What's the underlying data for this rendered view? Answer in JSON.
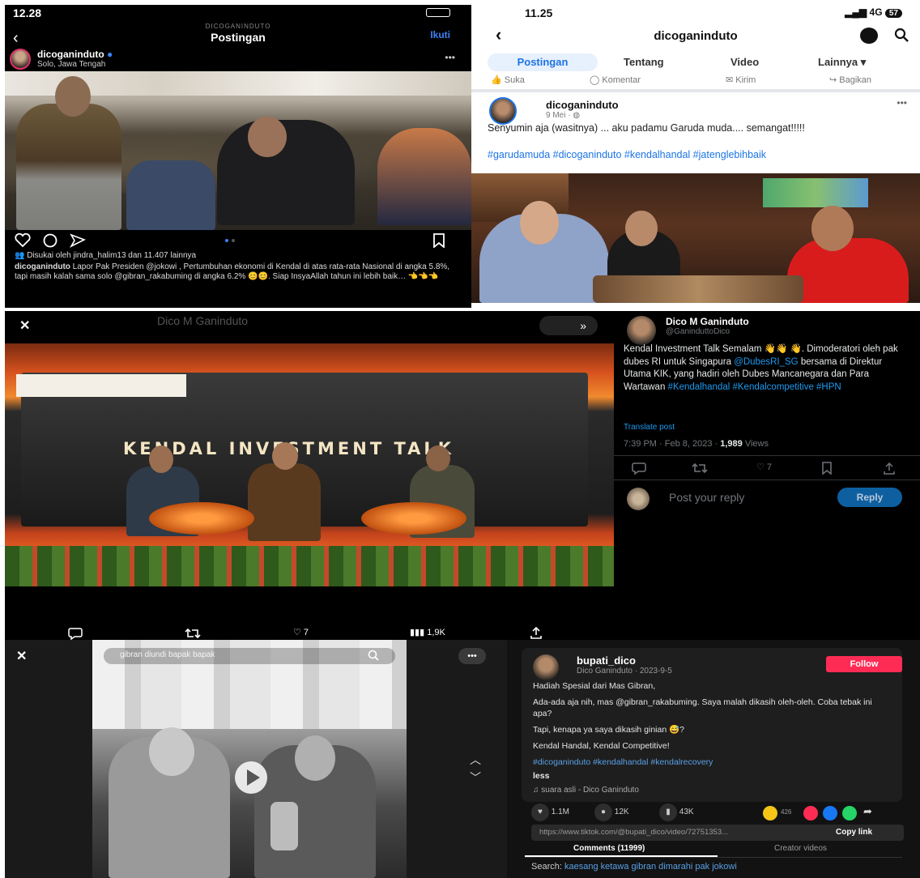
{
  "instagram": {
    "status_time": "12.28",
    "account_header_small": "DICOGANINDUTO",
    "header_title": "Postingan",
    "follow_label": "Ikuti",
    "username": "dicoganinduto",
    "location": "Solo, Jawa Tengah",
    "more": "•••",
    "liked_by": "Disukai oleh jindra_halim13 dan 11.407 lainnya",
    "caption_user": "dicoganinduto",
    "caption": "Lapor Pak Presiden @jokowi , Pertumbuhan ekonomi di Kendal di atas rata-rata Nasional di angka 5.8%, tapi masih kalah sama solo @gibran_rakabuming di angka 6.2% 😊😊. Siap InsyaAllah tahun ini lebih baik…",
    "caption_tail": "👈👈👈"
  },
  "facebook": {
    "status_time": "11.25",
    "status_network": "4G",
    "battery": "57",
    "page_title": "dicoganinduto",
    "tabs": [
      "Postingan",
      "Tentang",
      "Video",
      "Lainnya ▾"
    ],
    "actions": [
      "Suka",
      "Komentar",
      "Kirim",
      "Bagikan"
    ],
    "post_user": "dicoganinduto",
    "post_date": "9 Mei · ",
    "post_text": "Senyumin aja (wasitnya) ... aku padamu Garuda muda.... semangat!!!!!",
    "post_hashtags": "#garudamuda #dicoganinduto #kendalhandal #jatenglebihbaik",
    "more": "•••"
  },
  "twitter_video": {
    "close": "✕",
    "title": "Dico M Ganinduto",
    "banner_text": "KENDAL INVESTMENT TALK",
    "stats": [
      "7",
      "1,9K"
    ]
  },
  "twitter": {
    "name": "Dico M Ganinduto",
    "handle": "@GaninduttoDico",
    "tweet_line1": "Kendal Investment Talk Semalam 👋👋",
    "tweet_line2": "👋. Dimoderatori oleh pak dubes RI untuk Singapura",
    "tweet_mention": "@DubesRI_SG",
    "tweet_line3": "bersama di Direktur Utama KIK, yang hadiri oleh Dubes Mancanegara dan Para Wartawan",
    "tweet_tags": "#Kendalhandal #Kendalcompetitive #HPN",
    "translate": "Translate post",
    "time": "7:39 PM · Feb 8, 2023 · ",
    "views_count": "1,989",
    "views_label": "Views",
    "like_count": "7",
    "reply_placeholder": "Post your reply",
    "reply_button": "Reply"
  },
  "tiktok_video": {
    "close": "✕",
    "search": "gibran diundi bapak bapak",
    "more": "•••"
  },
  "tiktok": {
    "username": "bupati_dico",
    "sub": "Dico Ganinduto · 2023-9-5",
    "follow": "Follow",
    "line1": "Hadiah Spesial dari Mas Gibran,",
    "line2": "Ada-ada aja nih, mas @gibran_rakabuming. Saya malah dikasih oleh-oleh. Coba tebak ini apa?",
    "line3": "Tapi, kenapa ya saya dikasih ginian 😅?",
    "line4": "Kendal Handal, Kendal Competitive!",
    "hashtags": "#dicoganinduto #kendalhandal #kendalrecovery",
    "less": "less",
    "sound": "♫  suara asli - Dico Ganinduto",
    "likes": "1.1M",
    "comments_count": "12K",
    "saves": "43K",
    "shares": "426",
    "link": "https://www.tiktok.com/@bupati_dico/video/72751353...",
    "copy_link": "Copy link",
    "tab_comments": "Comments (11999)",
    "tab_creator": "Creator videos",
    "search_label": "Search:",
    "search_text": "kaesang ketawa gibran dimarahi pak jokowi"
  }
}
